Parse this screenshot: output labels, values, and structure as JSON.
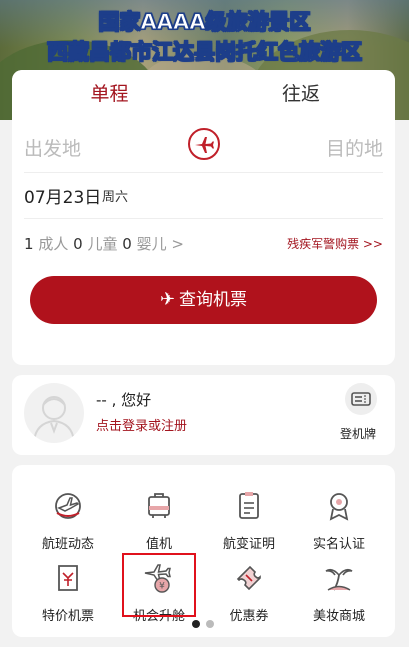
{
  "banner": {
    "line1": "国家AAAA级旅游景区",
    "line2": "西藏昌都市江达县岗托红色旅游区"
  },
  "booking": {
    "tabs": [
      "单程",
      "往返"
    ],
    "from_placeholder": "出发地",
    "to_placeholder": "目的地",
    "date": "07月23日",
    "weekday": "周六",
    "pax": {
      "adult_count": "1",
      "adult_label": "成人",
      "child_count": "0",
      "child_label": "儿童",
      "infant_count": "0",
      "infant_label": "婴儿",
      "chevron": ">"
    },
    "disabled_link": "残疾军警购票 >>",
    "search_button": "查询机票",
    "accent_color": "#b0121c"
  },
  "user": {
    "greeting": "-- , 您好",
    "login_link": "点击登录或注册",
    "boarding_label": "登机牌"
  },
  "services": {
    "items": [
      {
        "label": "航班动态",
        "icon": "flight-status-icon"
      },
      {
        "label": "值机",
        "icon": "checkin-icon"
      },
      {
        "label": "航变证明",
        "icon": "flight-change-certificate-icon"
      },
      {
        "label": "实名认证",
        "icon": "real-name-icon"
      },
      {
        "label": "特价机票",
        "icon": "special-ticket-icon"
      },
      {
        "label": "机会升舱",
        "icon": "upgrade-icon"
      },
      {
        "label": "优惠券",
        "icon": "coupon-icon"
      },
      {
        "label": "美妆商城",
        "icon": "beauty-mall-icon"
      }
    ]
  }
}
